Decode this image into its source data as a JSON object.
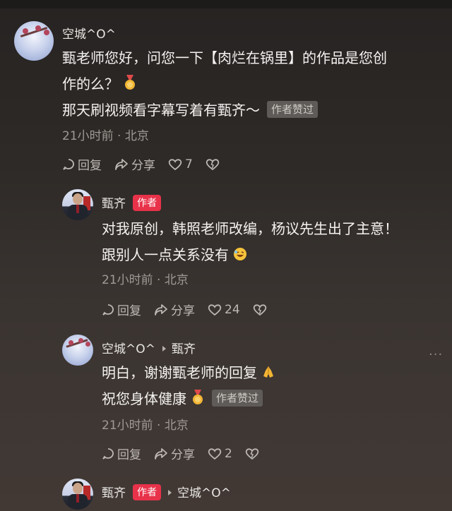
{
  "comments": [
    {
      "username": "空城^O^",
      "lines": [
        "甄老师您好，问您一下【肉烂在锅里】的作品是您创",
        "作的么？"
      ],
      "line3": "那天刷视频看字幕写着有甄齐～",
      "liked_badge": "作者赞过",
      "meta": "21小时前 · 北京",
      "reply": "回复",
      "share": "分享",
      "likes": "7"
    },
    {
      "username": "甄齐",
      "author_badge": "作者",
      "lines": [
        "对我原创，韩照老师改编，杨议先生出了主意！",
        "跟别人一点关系没有"
      ],
      "meta": "21小时前 · 北京",
      "reply": "回复",
      "share": "分享",
      "likes": "24"
    },
    {
      "username": "空城^O^",
      "reply_to": "甄齐",
      "lines": [
        "明白，谢谢甄老师的回复"
      ],
      "line2": "祝您身体健康",
      "liked_badge": "作者赞过",
      "meta": "21小时前 · 北京",
      "reply": "回复",
      "share": "分享",
      "likes": "2"
    },
    {
      "username": "甄齐",
      "author_badge": "作者",
      "reply_to": "空城^O^"
    }
  ],
  "more_label": "···"
}
